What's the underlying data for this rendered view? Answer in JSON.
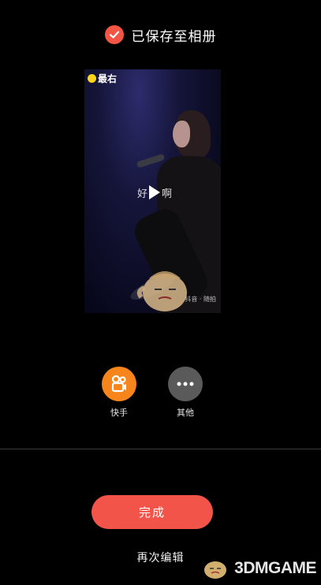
{
  "status": {
    "text": "已保存至相册"
  },
  "preview": {
    "logo_text": "最右",
    "caption": "好啊",
    "tiktok_watermark": "抖音 · 随拍"
  },
  "share": [
    {
      "label": "快手",
      "icon": "kuaishou-camera-icon",
      "color": "#f7851c"
    },
    {
      "label": "其他",
      "icon": "more-dots-icon",
      "color": "#5a5a5a"
    }
  ],
  "actions": {
    "done_label": "完成",
    "reedit_label": "再次编辑"
  },
  "watermark": {
    "text": "3DMGAME"
  },
  "colors": {
    "accent": "#f3544a",
    "check": "#f25544",
    "background": "#000000"
  }
}
